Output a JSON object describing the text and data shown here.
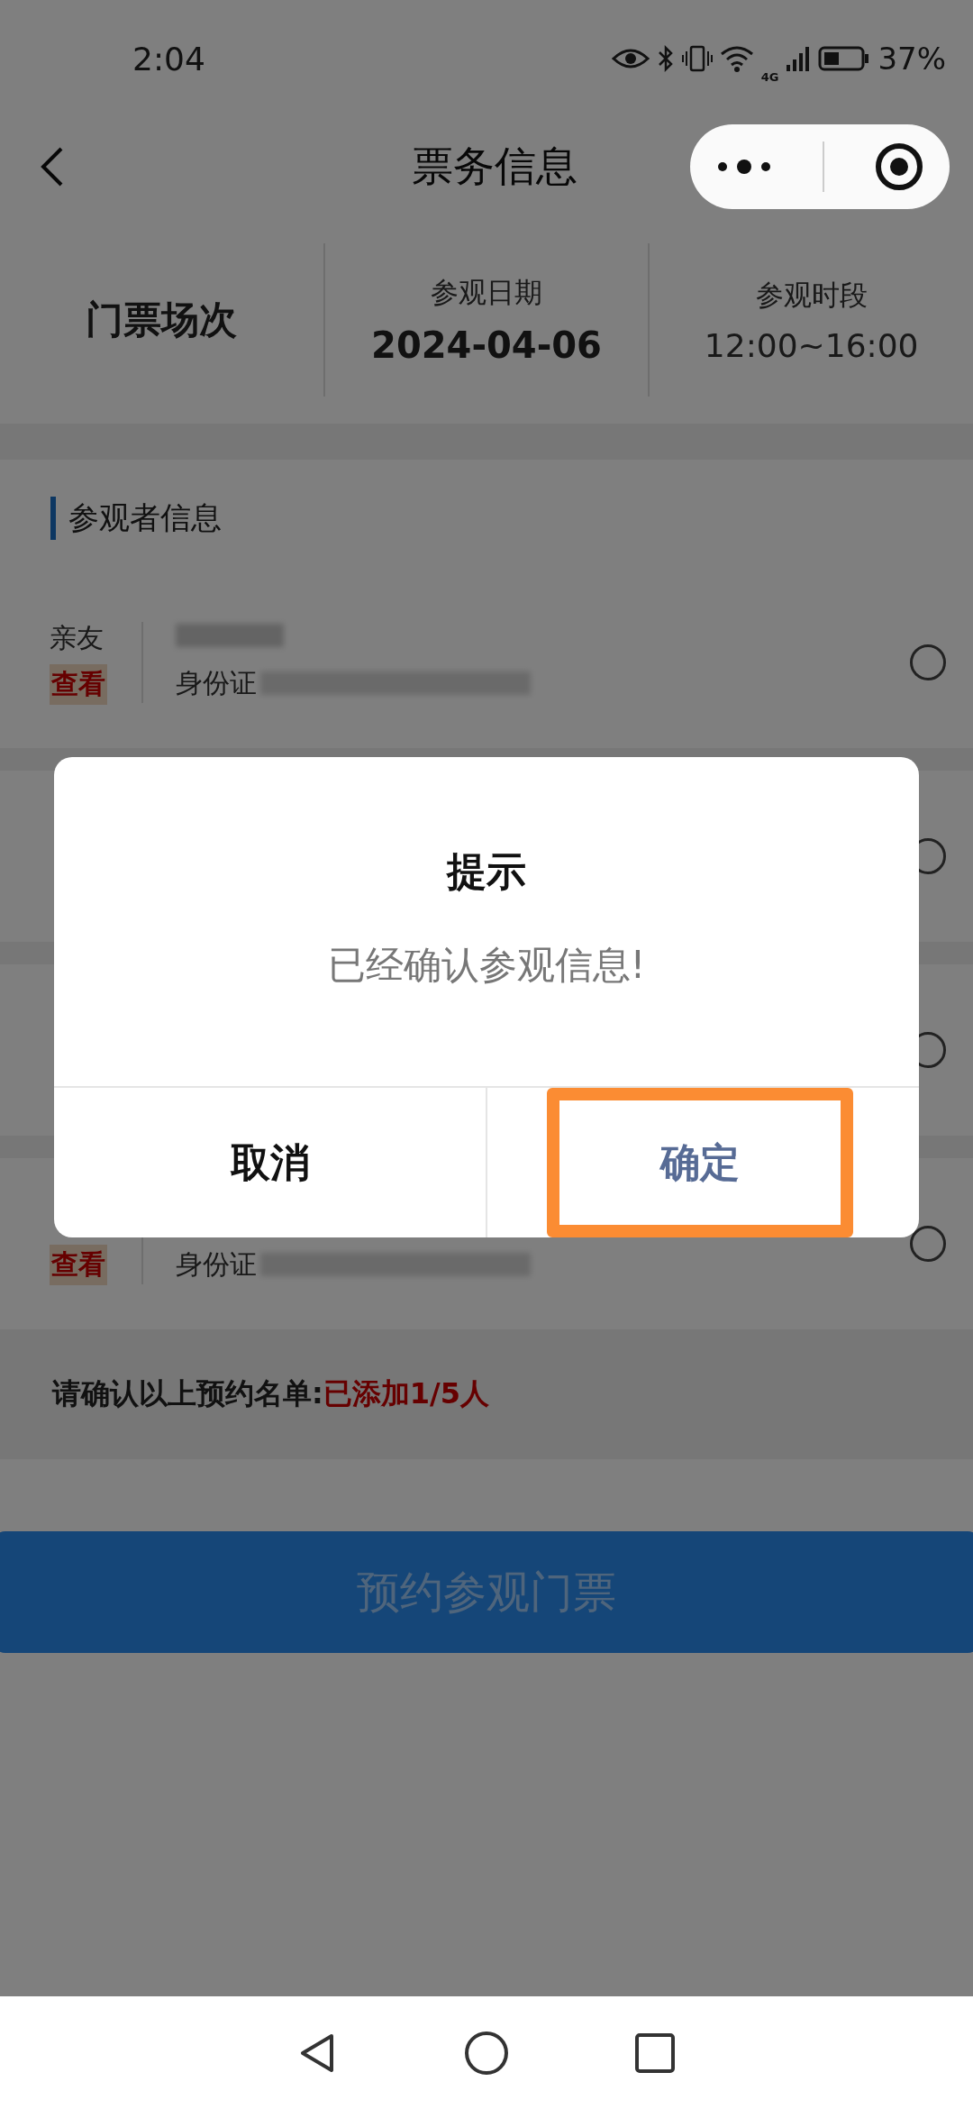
{
  "status_bar": {
    "time": "2:04",
    "network": "4G",
    "battery": "37%"
  },
  "nav": {
    "title": "票务信息"
  },
  "session": {
    "label": "门票场次",
    "date_label": "参观日期",
    "date": "2024-04-06",
    "time_label": "参观时段",
    "time": "12:00~16:00"
  },
  "visitors": {
    "title": "参观者信息",
    "rows": [
      {
        "name": "亲友",
        "view": "查看",
        "id_label": "身份证",
        "selected": false
      },
      {
        "selected": false
      },
      {
        "selected": false
      },
      {
        "view": "查看",
        "id_label": "身份证",
        "selected": false
      }
    ]
  },
  "summary": {
    "prefix": "请确认以上预约名单:",
    "count": "已添加1/5人"
  },
  "submit_button": "预约参观门票",
  "dialog": {
    "title": "提示",
    "message": "已经确认参观信息!",
    "buttons": [
      {
        "label": "取消",
        "kind": "cancel",
        "highlighted": false
      },
      {
        "label": "确定",
        "kind": "confirm",
        "highlighted": true
      }
    ]
  }
}
